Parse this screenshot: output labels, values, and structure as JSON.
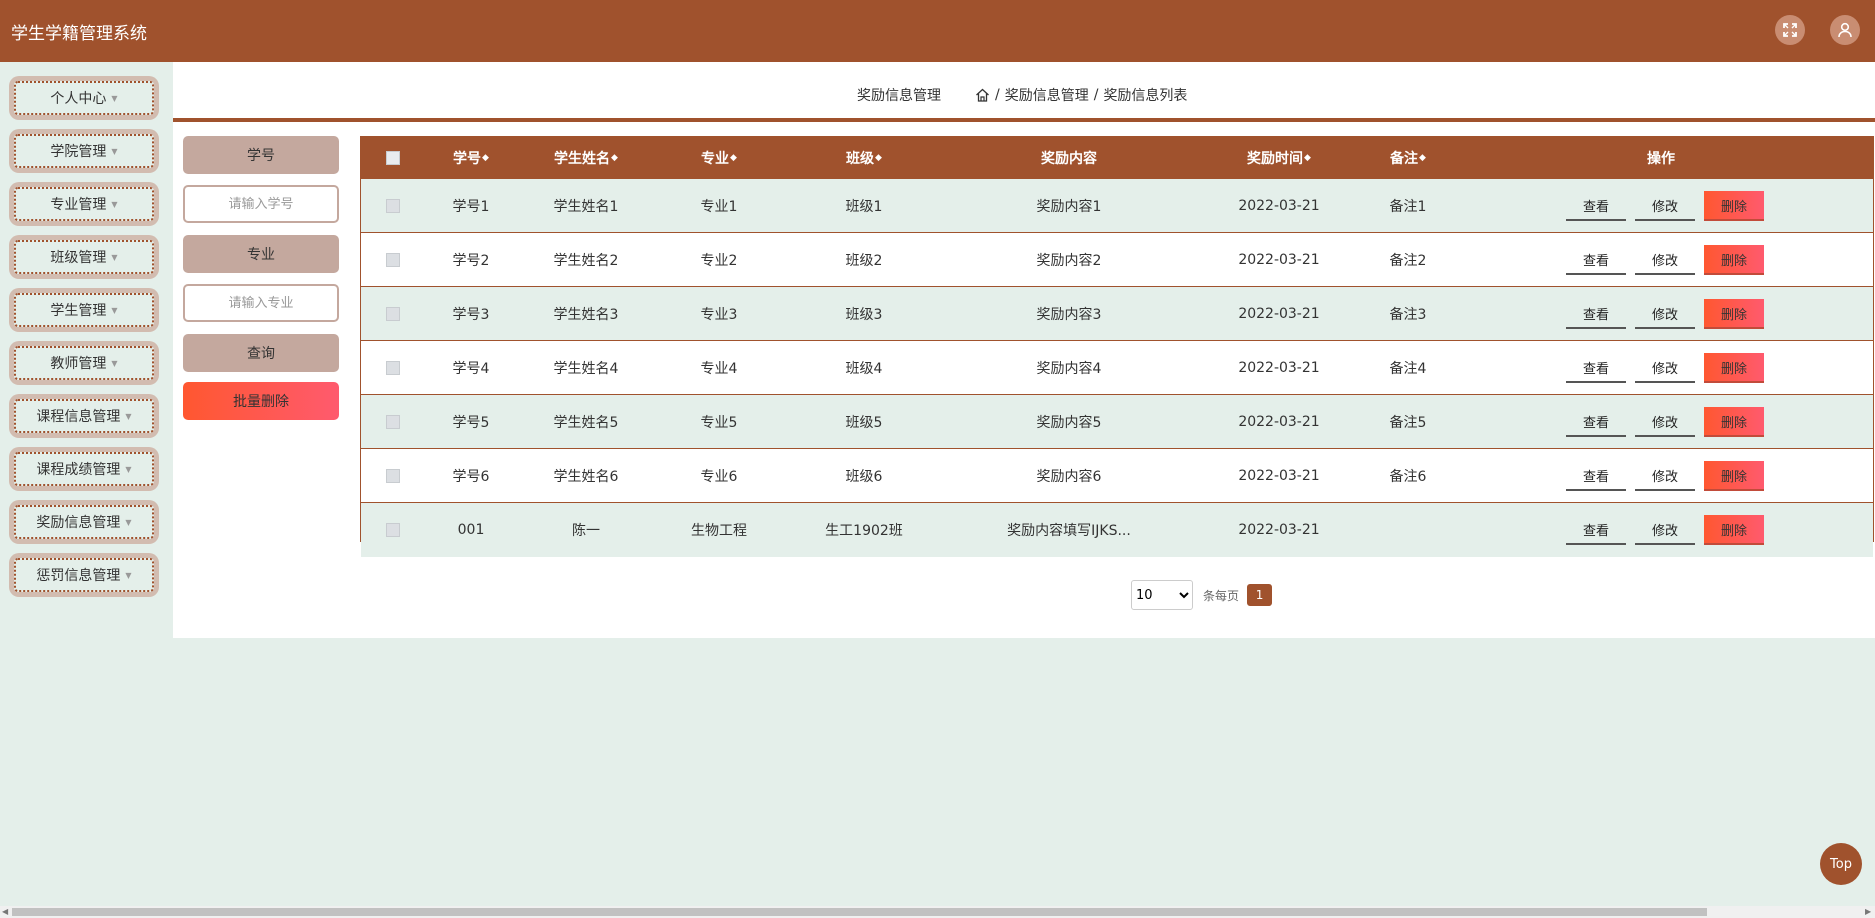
{
  "app": {
    "title": "学生学籍管理系统"
  },
  "header_icons": {
    "fullscreen": "fullscreen-icon",
    "user": "user-icon"
  },
  "sidebar": {
    "items": [
      {
        "label": "个人中心"
      },
      {
        "label": "学院管理"
      },
      {
        "label": "专业管理"
      },
      {
        "label": "班级管理"
      },
      {
        "label": "学生管理"
      },
      {
        "label": "教师管理"
      },
      {
        "label": "课程信息管理"
      },
      {
        "label": "课程成绩管理"
      },
      {
        "label": "奖励信息管理"
      },
      {
        "label": "惩罚信息管理"
      }
    ]
  },
  "breadcrumb": {
    "title": "奖励信息管理",
    "path": [
      "奖励信息管理",
      "奖励信息列表"
    ],
    "separator": "/"
  },
  "filters": {
    "student_no_label": "学号",
    "student_no_placeholder": "请输入学号",
    "major_label": "专业",
    "major_placeholder": "请输入专业",
    "search_label": "查询",
    "batch_delete_label": "批量删除"
  },
  "table": {
    "sort_glyph": "◆",
    "columns": {
      "student_no": "学号",
      "student_name": "学生姓名",
      "major": "专业",
      "class_name": "班级",
      "content": "奖励内容",
      "time": "奖励时间",
      "remark": "备注",
      "actions": "操作"
    },
    "rows": [
      {
        "student_no": "学号1",
        "student_name": "学生姓名1",
        "major": "专业1",
        "class_name": "班级1",
        "content": "奖励内容1",
        "time": "2022-03-21",
        "remark": "备注1"
      },
      {
        "student_no": "学号2",
        "student_name": "学生姓名2",
        "major": "专业2",
        "class_name": "班级2",
        "content": "奖励内容2",
        "time": "2022-03-21",
        "remark": "备注2"
      },
      {
        "student_no": "学号3",
        "student_name": "学生姓名3",
        "major": "专业3",
        "class_name": "班级3",
        "content": "奖励内容3",
        "time": "2022-03-21",
        "remark": "备注3"
      },
      {
        "student_no": "学号4",
        "student_name": "学生姓名4",
        "major": "专业4",
        "class_name": "班级4",
        "content": "奖励内容4",
        "time": "2022-03-21",
        "remark": "备注4"
      },
      {
        "student_no": "学号5",
        "student_name": "学生姓名5",
        "major": "专业5",
        "class_name": "班级5",
        "content": "奖励内容5",
        "time": "2022-03-21",
        "remark": "备注5"
      },
      {
        "student_no": "学号6",
        "student_name": "学生姓名6",
        "major": "专业6",
        "class_name": "班级6",
        "content": "奖励内容6",
        "time": "2022-03-21",
        "remark": "备注6"
      },
      {
        "student_no": "001",
        "student_name": "陈一",
        "major": "生物工程",
        "class_name": "生工1902班",
        "content": "奖励内容填写IJKS...",
        "time": "2022-03-21",
        "remark": ""
      }
    ],
    "actions": {
      "view": "查看",
      "edit": "修改",
      "delete": "删除"
    }
  },
  "pagination": {
    "page_size": "10",
    "page_size_options": [
      "10"
    ],
    "per_page_label": "条每页",
    "current_page": "1"
  },
  "back_to_top": "Top",
  "colors": {
    "primary": "#a0522d",
    "background": "#e4efea",
    "delete": "#ff5a5a",
    "filter_label": "#c4a89e"
  }
}
